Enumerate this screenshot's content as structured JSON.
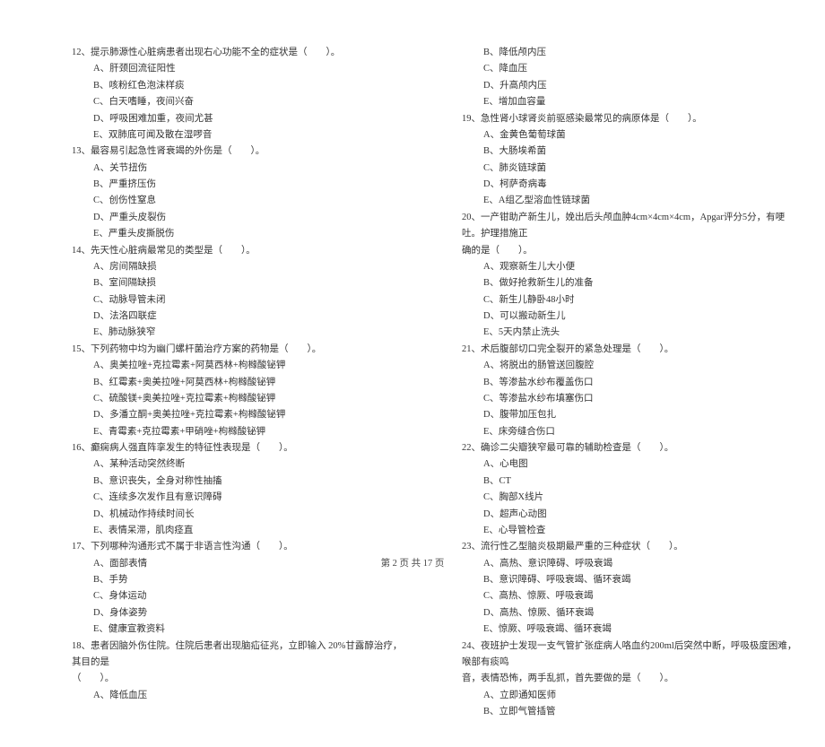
{
  "left": {
    "q12": {
      "stem": "12、提示肺源性心脏病患者出现右心功能不全的症状是（　　）。",
      "A": "A、肝颈回流征阳性",
      "B": "B、咳粉红色泡沫样痰",
      "C": "C、白天嗜睡，夜间兴奋",
      "D": "D、呼吸困难加重，夜间尤甚",
      "E": "E、双肺底可闻及散在湿啰音"
    },
    "q13": {
      "stem": "13、最容易引起急性肾衰竭的外伤是（　　）。",
      "A": "A、关节扭伤",
      "B": "B、严重挤压伤",
      "C": "C、创伤性窒息",
      "D": "D、严重头皮裂伤",
      "E": "E、严重头皮撕脱伤"
    },
    "q14": {
      "stem": "14、先天性心脏病最常见的类型是（　　）。",
      "A": "A、房间隔缺损",
      "B": "B、室间隔缺损",
      "C": "C、动脉导管未闭",
      "D": "D、法洛四联症",
      "E": "E、肺动脉狭窄"
    },
    "q15": {
      "stem": "15、下列药物中均为幽门螺杆菌治疗方案的药物是（　　）。",
      "A": "A、奥美拉唑+克拉霉素+阿莫西林+枸橼酸铋钾",
      "B": "B、红霉素+奥美拉唑+阿莫西林+枸橼酸铋钾",
      "C": "C、硫酸镁+奥美拉唑+克拉霉素+枸橼酸铋钾",
      "D": "D、多潘立酮+奥美拉唑+克拉霉素+枸橼酸铋钾",
      "E": "E、青霉素+克拉霉素+甲硝唑+枸橼酸铋钾"
    },
    "q16": {
      "stem": "16、癫痫病人强直阵挛发生的特征性表现是（　　）。",
      "A": "A、某种活动突然终断",
      "B": "B、意识丧失，全身对称性抽搐",
      "C": "C、连续多次发作且有意识障碍",
      "D": "D、机械动作持续时间长",
      "E": "E、表情呆滞，肌肉痉直"
    },
    "q17": {
      "stem": "17、下列哪种沟通形式不属于非语言性沟通（　　）。",
      "A": "A、面部表情",
      "B": "B、手势",
      "C": "C、身体运动",
      "D": "D、身体姿势",
      "E": "E、健康宣教资料"
    },
    "q18": {
      "stem": "18、患者因脑外伤住院。住院后患者出现脑疝征兆，立即输入 20%甘露醇治疗，其目的是",
      "stem_cont": "（　　）。",
      "A": "A、降低血压"
    }
  },
  "right": {
    "q18_cont": {
      "B": "B、降低颅内压",
      "C": "C、降血压",
      "D": "D、升高颅内压",
      "E": "E、增加血容量"
    },
    "q19": {
      "stem": "19、急性肾小球肾炎前驱感染最常见的病原体是（　　）。",
      "A": "A、金黄色葡萄球菌",
      "B": "B、大肠埃希菌",
      "C": "C、肺炎链球菌",
      "D": "D、柯萨奇病毒",
      "E": "E、A组乙型溶血性链球菌"
    },
    "q20": {
      "stem": "20、一产钳助产新生儿，娩出后头颅血肿4cm×4cm×4cm，Apgar评分5分，有哽吐。护理措施正",
      "stem_cont": "确的是（　　）。",
      "A": "A、观察新生儿大小便",
      "B": "B、做好抢救新生儿的准备",
      "C": "C、新生儿静卧48小时",
      "D": "D、可以搬动新生儿",
      "E": "E、5天内禁止洗头"
    },
    "q21": {
      "stem": "21、术后腹部切口完全裂开的紧急处理是（　　）。",
      "A": "A、将脱出的肠管送回腹腔",
      "B": "B、等渗盐水纱布覆盖伤口",
      "C": "C、等渗盐水纱布填塞伤口",
      "D": "D、腹带加压包扎",
      "E": "E、床旁缝合伤口"
    },
    "q22": {
      "stem": "22、确诊二尖瓣狭窄最可靠的辅助检查是（　　）。",
      "A": "A、心电图",
      "B": "B、CT",
      "C": "C、胸部X线片",
      "D": "D、超声心动图",
      "E": "E、心导管检查"
    },
    "q23": {
      "stem": "23、流行性乙型脑炎极期最严重的三种症状（　　）。",
      "A": "A、高热、意识障碍、呼吸衰竭",
      "B": "B、意识障碍、呼吸衰竭、循环衰竭",
      "C": "C、高热、惊厥、呼吸衰竭",
      "D": "D、高热、惊厥、循环衰竭",
      "E": "E、惊厥、呼吸衰竭、循环衰竭"
    },
    "q24": {
      "stem": "24、夜班护士发现一支气管扩张症病人咯血约200ml后突然中断，呼吸极度困难，喉部有痰鸣",
      "stem_cont": "音，表情恐怖，两手乱抓，首先要做的是（　　）。",
      "A": "A、立即通知医师",
      "B": "B、立即气管插管"
    }
  },
  "footer": "第 2 页 共 17 页"
}
